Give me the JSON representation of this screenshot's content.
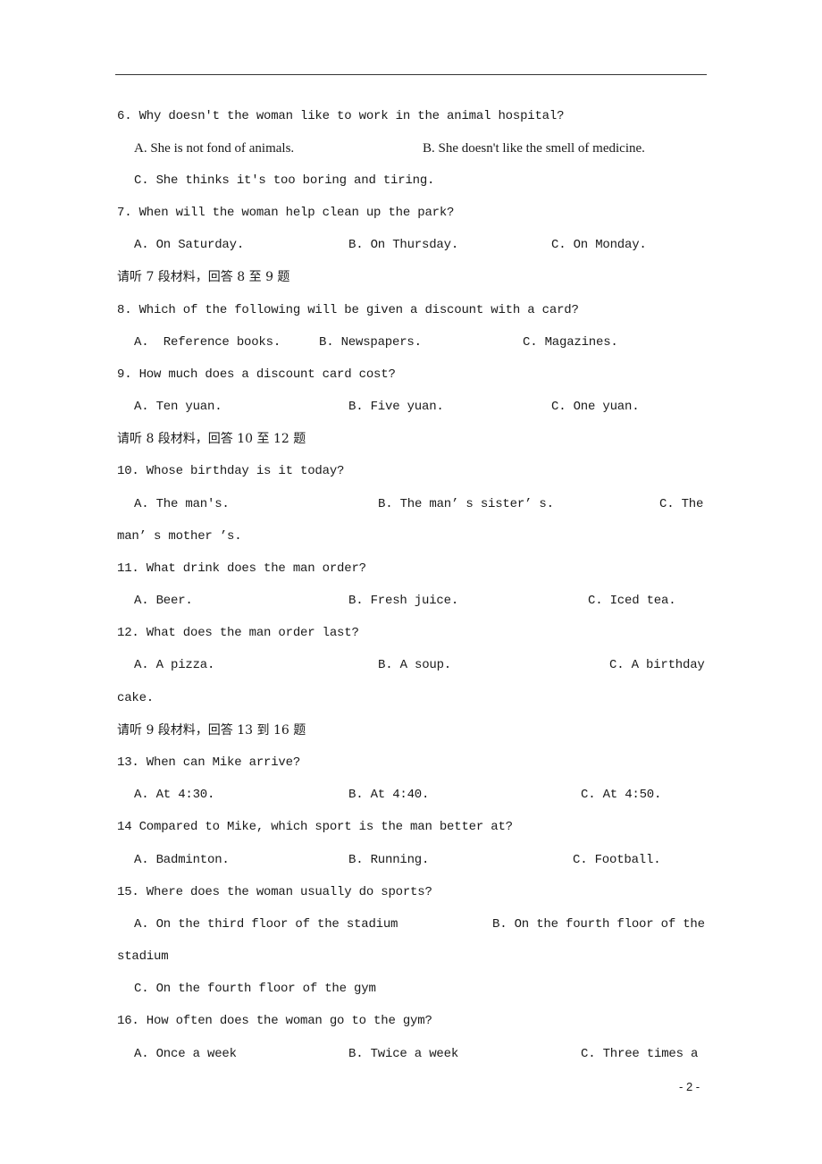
{
  "q6": {
    "question": "6. Why doesn't the woman like to work in the animal hospital?",
    "a": "A. She is not fond of animals.",
    "b": "B. She doesn't like the smell of medicine.",
    "c": "C. She thinks it's too boring and tiring."
  },
  "q7": {
    "question": "7. When will the woman help clean up the park?",
    "a": "A. On Saturday.",
    "b": "B. On Thursday.",
    "c": "C. On Monday."
  },
  "section7": "请听 7 段材料，回答 8 至 9 题",
  "q8": {
    "question": "8. Which of the following will be given a discount with a card?",
    "a": "A.  Reference books.",
    "b": "B. Newspapers.",
    "c": "C. Magazines."
  },
  "q9": {
    "question": "9. How much does a discount card cost?",
    "a": "A. Ten yuan.",
    "b": "B. Five yuan.",
    "c": "C. One yuan."
  },
  "section8": "请听 8 段材料，回答 10 至 12 题",
  "q10": {
    "question": "10. Whose birthday is it today?",
    "a": "A. The man's.",
    "b": "B. The man’ s sister’ s.",
    "c": "C. The",
    "c_cont": "man’ s mother ’s."
  },
  "q11": {
    "question": "11. What drink does the man order?",
    "a": "A. Beer.",
    "b": "B. Fresh juice.",
    "c": "C. Iced tea."
  },
  "q12": {
    "question": "12. What does the man order last?",
    "a": "A. A pizza.",
    "b": "B. A soup.",
    "c": "C. A birthday",
    "c_cont": "cake."
  },
  "section9": "请听 9 段材料，回答 13 到 16 题",
  "q13": {
    "question": "13. When can Mike arrive?",
    "a": "A. At 4:30.",
    "b": "B. At 4:40.",
    "c": "C. At 4:50."
  },
  "q14": {
    "question": "14 Compared to Mike, which sport is the man better at?",
    "a": "A. Badminton.",
    "b": "B. Running.",
    "c": "C. Football."
  },
  "q15": {
    "question": "15. Where does the woman usually do sports?",
    "a": "A. On the third floor of the stadium",
    "b": "B. On the fourth floor of the",
    "b_cont": "stadium",
    "c": "C. On the fourth floor of the gym"
  },
  "q16": {
    "question": "16. How often does the woman go to the gym?",
    "a": "A. Once a week",
    "b": "B. Twice a week",
    "c": "C. Three times a"
  },
  "page_number": "- 2 -"
}
